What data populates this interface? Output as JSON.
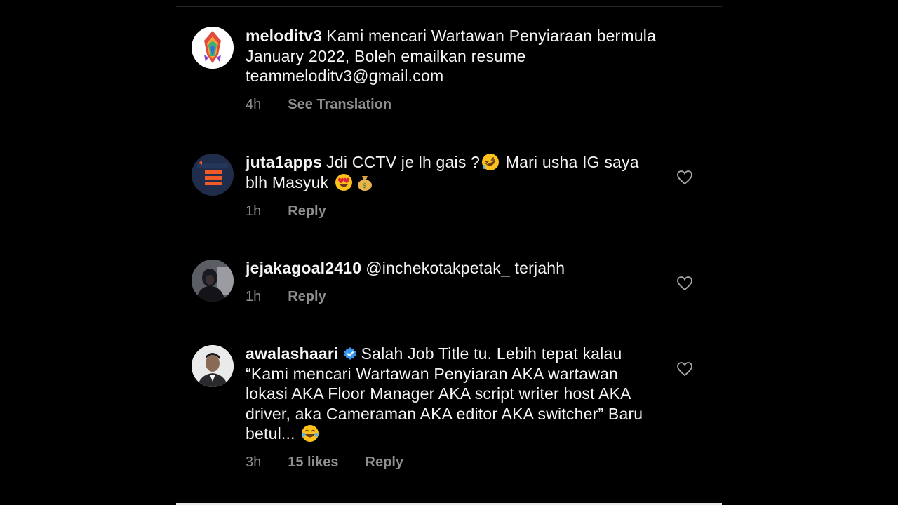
{
  "caption": {
    "username": "meloditv3",
    "text": "Kami mencari Wartawan Penyiaraan bermula January 2022, Boleh emailkan resume teammeloditv3@gmail.com",
    "time": "4h",
    "see_translation_label": "See Translation",
    "avatar_icon": "meloditv3-logo-avatar"
  },
  "comments": [
    {
      "username": "juta1apps",
      "text_part1": "Jdi CCTV je lh gais ?",
      "text_part2": " Mari usha IG saya blh Masyuk ",
      "emojis": [
        "rofl-emoji",
        "heart-eyes-emoji",
        "money-bag-emoji"
      ],
      "time": "1h",
      "reply_label": "Reply"
    },
    {
      "username": "jejakagoal2410",
      "text": "@inchekotakpetak_ terjahh",
      "time": "1h",
      "reply_label": "Reply"
    },
    {
      "username": "awalashaari",
      "verified": true,
      "text": "Salah Job Title tu. Lebih tepat kalau “Kami mencari Wartawan Penyiaran AKA wartawan lokasi AKA Floor Manager AKA script writer host AKA driver, aka Cameraman AKA editor AKA switcher” Baru betul... ",
      "emojis": [
        "tears-of-joy-emoji"
      ],
      "time": "3h",
      "likes": "15 likes",
      "reply_label": "Reply"
    }
  ],
  "colors": {
    "background": "#000000",
    "text": "#f5f5f5",
    "secondary_text": "#8e8e8e",
    "divider": "#262626",
    "verified": "#3897f0"
  }
}
